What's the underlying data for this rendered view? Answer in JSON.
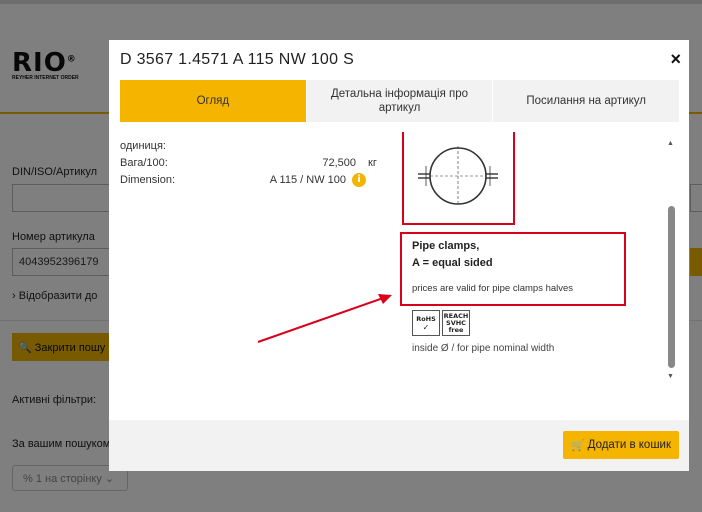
{
  "background": {
    "logo": "RIO",
    "logo_reg": "®",
    "logo_sub": "REYHER INTERNET ORDER",
    "din_label": "DIN/ISO/Артикул",
    "article_label": "Номер артикула",
    "article_value": "4043952396179",
    "show_more": "Відобразити до",
    "close_search": "Закрити пошу",
    "active_filters": "Активні фільтри:",
    "search_label": "За вашим пошуком",
    "per_page": "% 1 на сторінку"
  },
  "modal": {
    "title": "D 3567 1.4571 A 115 NW 100 S",
    "close_symbol": "×",
    "tabs": [
      {
        "label": "Огляд"
      },
      {
        "label": "Детальна інформація про артикул"
      },
      {
        "label": "Посилання на артикул"
      }
    ],
    "info": {
      "unit_label": "одиниця:",
      "weight_label": "Вага/100:",
      "weight_value": "72,500",
      "weight_unit": "кг",
      "dimension_label": "Dimension:",
      "dimension_value": "A 115 / NW 100",
      "info_icon": "i"
    },
    "product": {
      "title_line1": "Pipe clamps,",
      "title_line2": "A = equal sided",
      "note": "prices are valid for pipe clamps halves",
      "badges": {
        "rohs": "RoHS",
        "rohs_check": "✓",
        "reach1": "REACH",
        "reach2": "SVHC",
        "reach3": "free"
      },
      "pipe_note": "inside Ø / for pipe nominal width"
    },
    "footer": {
      "cart_button": "Додати в кошик",
      "cart_icon": "cart-icon"
    }
  },
  "colors": {
    "accent": "#f5b400",
    "annotation_red": "#d9001b"
  }
}
